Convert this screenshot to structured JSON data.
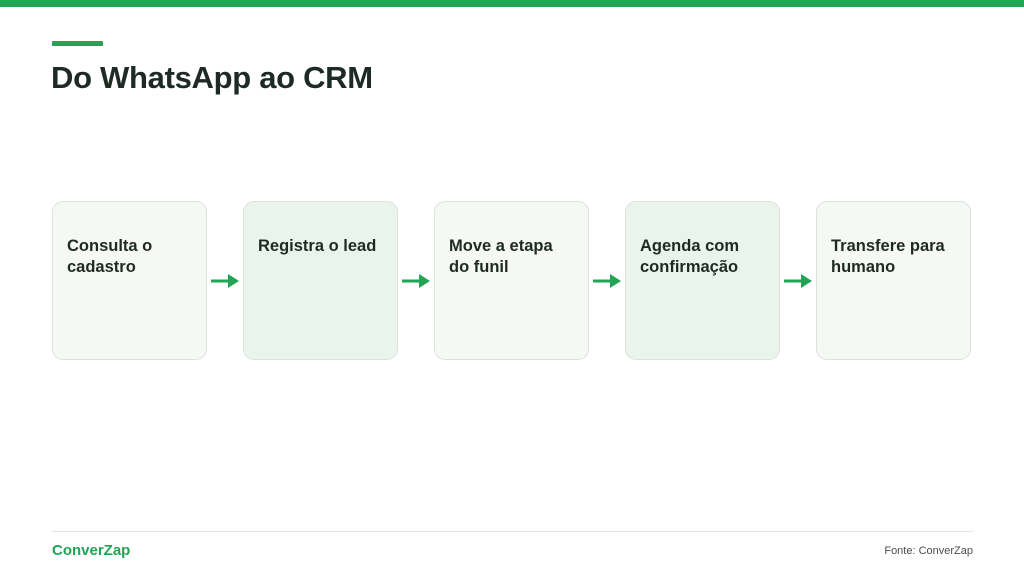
{
  "colors": {
    "accent": "#21a453",
    "title": "#1e2a24",
    "card_neutral_bg": "#f6f8f6",
    "card_highlight_bg": "#e9f5ec",
    "card_border": "#dde2dd",
    "card_text": "#1e2a24"
  },
  "header": {
    "title": "Do WhatsApp ao CRM"
  },
  "flow": {
    "steps": [
      {
        "label": "Consulta o cadastro",
        "highlighted": false
      },
      {
        "label": "Registra o lead",
        "highlighted": true
      },
      {
        "label": "Move a etapa do funil",
        "highlighted": false
      },
      {
        "label": "Agenda com confirmação",
        "highlighted": true
      },
      {
        "label": "Transfere para humano",
        "highlighted": false
      }
    ],
    "connector_icon": "arrow-right-icon"
  },
  "footer": {
    "brand": "ConverZap",
    "source": "Fonte: ConverZap"
  }
}
